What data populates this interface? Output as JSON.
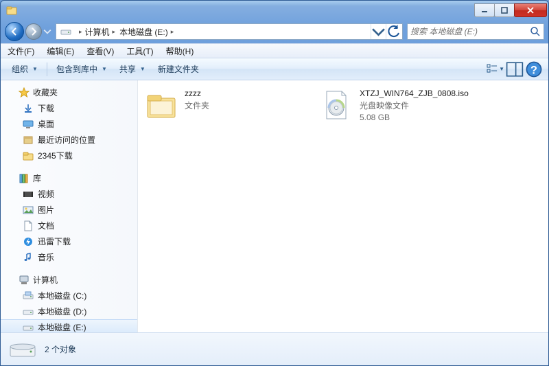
{
  "titlebar": {
    "min_tip": "Minimize",
    "max_tip": "Maximize",
    "close_tip": "Close"
  },
  "nav": {
    "breadcrumb": [
      {
        "label": "计算机"
      },
      {
        "label": "本地磁盘 (E:)"
      }
    ],
    "search_placeholder": "搜索 本地磁盘 (E:)"
  },
  "menu": {
    "file": "文件(F)",
    "edit": "编辑(E)",
    "view": "查看(V)",
    "tools": "工具(T)",
    "help": "帮助(H)"
  },
  "toolbar": {
    "organize": "组织",
    "include": "包含到库中",
    "share": "共享",
    "newfolder": "新建文件夹"
  },
  "sidebar": {
    "favorites": {
      "label": "收藏夹",
      "items": [
        "下载",
        "桌面",
        "最近访问的位置",
        "2345下载"
      ]
    },
    "libraries": {
      "label": "库",
      "items": [
        "视频",
        "图片",
        "文档",
        "迅雷下载",
        "音乐"
      ]
    },
    "computer": {
      "label": "计算机",
      "items": [
        "本地磁盘 (C:)",
        "本地磁盘 (D:)",
        "本地磁盘 (E:)"
      ]
    }
  },
  "files": [
    {
      "name": "zzzz",
      "type": "文件夹",
      "size": ""
    },
    {
      "name": "XTZJ_WIN764_ZJB_0808.iso",
      "type": "光盘映像文件",
      "size": "5.08 GB"
    }
  ],
  "status": {
    "count_label": "2 个对象"
  }
}
